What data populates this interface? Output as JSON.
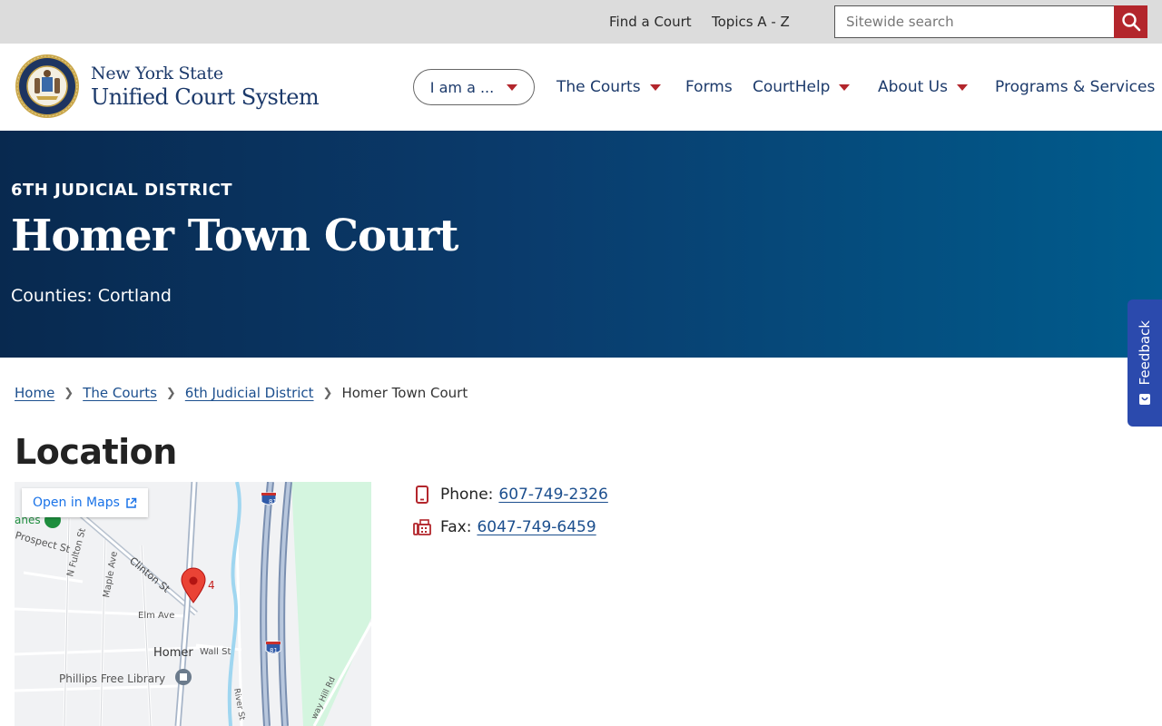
{
  "utility": {
    "find_court": "Find a Court",
    "topics": "Topics A - Z",
    "search_placeholder": "Sitewide search"
  },
  "brand": {
    "line1": "New York State",
    "line2": "Unified Court System",
    "seal_text": "NEW YORK STATE UNIFIED COURT SYSTEM"
  },
  "nav": {
    "i_am": "I am a ...",
    "items": [
      "The Courts",
      "Forms",
      "CourtHelp",
      "About Us",
      "Programs & Services"
    ]
  },
  "hero": {
    "kicker": "6TH JUDICIAL DISTRICT",
    "title": "Homer Town Court",
    "counties": "Counties: Cortland"
  },
  "feedback": {
    "label": "Feedback"
  },
  "breadcrumb": {
    "items": [
      "Home",
      "The Courts",
      "6th Judicial District"
    ],
    "current": "Homer Town Court"
  },
  "location": {
    "title": "Location",
    "open_in_maps": "Open in Maps",
    "phone_label": "Phone:",
    "phone": "607-749-2326",
    "fax_label": "Fax:",
    "fax": "6047-749-6459"
  },
  "map": {
    "labels": {
      "prospect": "Prospect St",
      "fulton": "N Fulton St",
      "maple": "Maple Ave",
      "clinton": "Clinton St",
      "elm": "Elm Ave",
      "homer": "Homer",
      "wall": "Wall St",
      "library": "Phillips Free Library",
      "river": "River St",
      "hill": "way Hill Rd",
      "lanes": "anes",
      "interstate": "81",
      "pin_label": "4"
    }
  },
  "colors": {
    "brand_navy": "#1c3a6b",
    "accent_red": "#b3262c",
    "link_blue": "#1c4f8e",
    "hero_start": "#08294f",
    "hero_end": "#005c8d",
    "feedback_blue": "#2b4aad"
  }
}
